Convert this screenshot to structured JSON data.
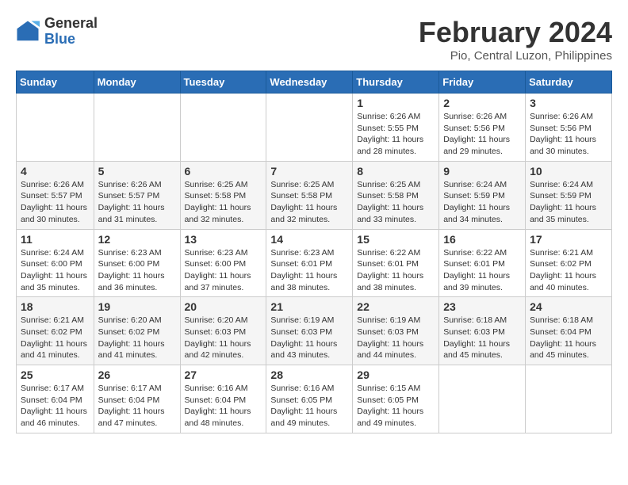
{
  "header": {
    "logo_general": "General",
    "logo_blue": "Blue",
    "month_year": "February 2024",
    "location": "Pio, Central Luzon, Philippines"
  },
  "days_of_week": [
    "Sunday",
    "Monday",
    "Tuesday",
    "Wednesday",
    "Thursday",
    "Friday",
    "Saturday"
  ],
  "weeks": [
    [
      {
        "day": "",
        "info": ""
      },
      {
        "day": "",
        "info": ""
      },
      {
        "day": "",
        "info": ""
      },
      {
        "day": "",
        "info": ""
      },
      {
        "day": "1",
        "info": "Sunrise: 6:26 AM\nSunset: 5:55 PM\nDaylight: 11 hours\nand 28 minutes."
      },
      {
        "day": "2",
        "info": "Sunrise: 6:26 AM\nSunset: 5:56 PM\nDaylight: 11 hours\nand 29 minutes."
      },
      {
        "day": "3",
        "info": "Sunrise: 6:26 AM\nSunset: 5:56 PM\nDaylight: 11 hours\nand 30 minutes."
      }
    ],
    [
      {
        "day": "4",
        "info": "Sunrise: 6:26 AM\nSunset: 5:57 PM\nDaylight: 11 hours\nand 30 minutes."
      },
      {
        "day": "5",
        "info": "Sunrise: 6:26 AM\nSunset: 5:57 PM\nDaylight: 11 hours\nand 31 minutes."
      },
      {
        "day": "6",
        "info": "Sunrise: 6:25 AM\nSunset: 5:58 PM\nDaylight: 11 hours\nand 32 minutes."
      },
      {
        "day": "7",
        "info": "Sunrise: 6:25 AM\nSunset: 5:58 PM\nDaylight: 11 hours\nand 32 minutes."
      },
      {
        "day": "8",
        "info": "Sunrise: 6:25 AM\nSunset: 5:58 PM\nDaylight: 11 hours\nand 33 minutes."
      },
      {
        "day": "9",
        "info": "Sunrise: 6:24 AM\nSunset: 5:59 PM\nDaylight: 11 hours\nand 34 minutes."
      },
      {
        "day": "10",
        "info": "Sunrise: 6:24 AM\nSunset: 5:59 PM\nDaylight: 11 hours\nand 35 minutes."
      }
    ],
    [
      {
        "day": "11",
        "info": "Sunrise: 6:24 AM\nSunset: 6:00 PM\nDaylight: 11 hours\nand 35 minutes."
      },
      {
        "day": "12",
        "info": "Sunrise: 6:23 AM\nSunset: 6:00 PM\nDaylight: 11 hours\nand 36 minutes."
      },
      {
        "day": "13",
        "info": "Sunrise: 6:23 AM\nSunset: 6:00 PM\nDaylight: 11 hours\nand 37 minutes."
      },
      {
        "day": "14",
        "info": "Sunrise: 6:23 AM\nSunset: 6:01 PM\nDaylight: 11 hours\nand 38 minutes."
      },
      {
        "day": "15",
        "info": "Sunrise: 6:22 AM\nSunset: 6:01 PM\nDaylight: 11 hours\nand 38 minutes."
      },
      {
        "day": "16",
        "info": "Sunrise: 6:22 AM\nSunset: 6:01 PM\nDaylight: 11 hours\nand 39 minutes."
      },
      {
        "day": "17",
        "info": "Sunrise: 6:21 AM\nSunset: 6:02 PM\nDaylight: 11 hours\nand 40 minutes."
      }
    ],
    [
      {
        "day": "18",
        "info": "Sunrise: 6:21 AM\nSunset: 6:02 PM\nDaylight: 11 hours\nand 41 minutes."
      },
      {
        "day": "19",
        "info": "Sunrise: 6:20 AM\nSunset: 6:02 PM\nDaylight: 11 hours\nand 41 minutes."
      },
      {
        "day": "20",
        "info": "Sunrise: 6:20 AM\nSunset: 6:03 PM\nDaylight: 11 hours\nand 42 minutes."
      },
      {
        "day": "21",
        "info": "Sunrise: 6:19 AM\nSunset: 6:03 PM\nDaylight: 11 hours\nand 43 minutes."
      },
      {
        "day": "22",
        "info": "Sunrise: 6:19 AM\nSunset: 6:03 PM\nDaylight: 11 hours\nand 44 minutes."
      },
      {
        "day": "23",
        "info": "Sunrise: 6:18 AM\nSunset: 6:03 PM\nDaylight: 11 hours\nand 45 minutes."
      },
      {
        "day": "24",
        "info": "Sunrise: 6:18 AM\nSunset: 6:04 PM\nDaylight: 11 hours\nand 45 minutes."
      }
    ],
    [
      {
        "day": "25",
        "info": "Sunrise: 6:17 AM\nSunset: 6:04 PM\nDaylight: 11 hours\nand 46 minutes."
      },
      {
        "day": "26",
        "info": "Sunrise: 6:17 AM\nSunset: 6:04 PM\nDaylight: 11 hours\nand 47 minutes."
      },
      {
        "day": "27",
        "info": "Sunrise: 6:16 AM\nSunset: 6:04 PM\nDaylight: 11 hours\nand 48 minutes."
      },
      {
        "day": "28",
        "info": "Sunrise: 6:16 AM\nSunset: 6:05 PM\nDaylight: 11 hours\nand 49 minutes."
      },
      {
        "day": "29",
        "info": "Sunrise: 6:15 AM\nSunset: 6:05 PM\nDaylight: 11 hours\nand 49 minutes."
      },
      {
        "day": "",
        "info": ""
      },
      {
        "day": "",
        "info": ""
      }
    ]
  ]
}
